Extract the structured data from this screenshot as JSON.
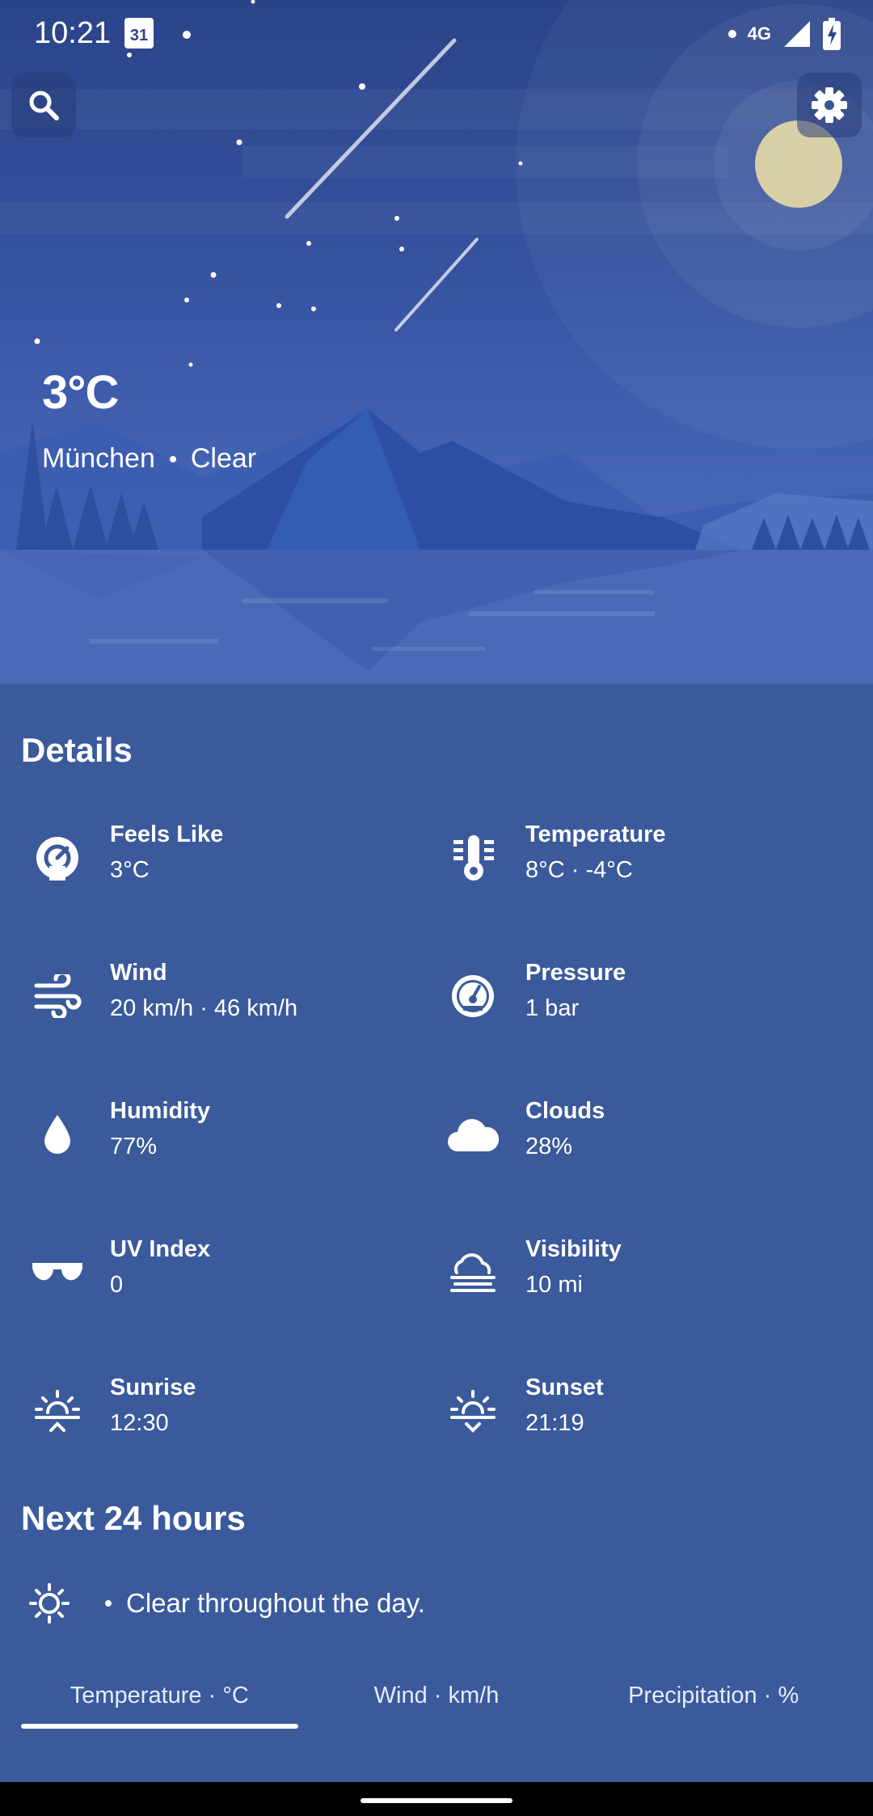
{
  "status_bar": {
    "time": "10:21",
    "calendar_day": "31",
    "network": "4G"
  },
  "hero": {
    "temperature": "3°C",
    "city": "München",
    "condition": "Clear"
  },
  "details": {
    "title": "Details",
    "items": [
      {
        "name": "Feels Like",
        "value": "3°C",
        "icon": "feels-like-gauge-icon"
      },
      {
        "name": "Temperature",
        "value": "8°C · -4°C",
        "icon": "thermometer-icon"
      },
      {
        "name": "Wind",
        "value": "20 km/h · 46 km/h",
        "icon": "wind-icon"
      },
      {
        "name": "Pressure",
        "value": "1 bar",
        "icon": "barometer-icon"
      },
      {
        "name": "Humidity",
        "value": "77%",
        "icon": "water-drop-icon"
      },
      {
        "name": "Clouds",
        "value": "28%",
        "icon": "cloud-icon"
      },
      {
        "name": "UV Index",
        "value": "0",
        "icon": "sunglasses-icon"
      },
      {
        "name": "Visibility",
        "value": "10 mi",
        "icon": "fog-icon"
      },
      {
        "name": "Sunrise",
        "value": "12:30",
        "icon": "sunrise-icon"
      },
      {
        "name": "Sunset",
        "value": "21:19",
        "icon": "sunset-icon"
      }
    ]
  },
  "next24": {
    "title": "Next 24 hours",
    "summary": "Clear throughout the day.",
    "tabs": [
      "Temperature · °C",
      "Wind · km/h",
      "Precipitation · %"
    ],
    "active_tab": "Temperature · °C"
  },
  "colors": {
    "background": "#3a5a9b",
    "hero_top": "#2b4389",
    "moon": "#d8cfa8"
  }
}
